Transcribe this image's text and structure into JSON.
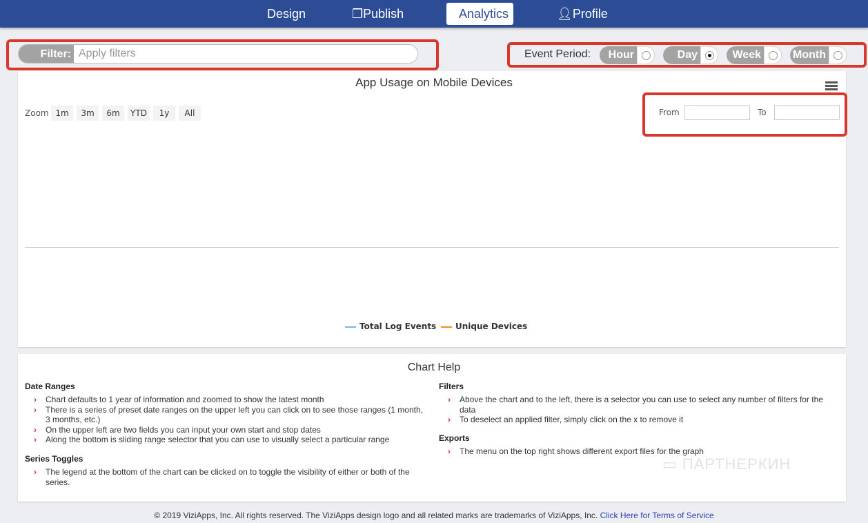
{
  "nav": {
    "tabs": [
      {
        "label": "Design"
      },
      {
        "label": "Publish",
        "icon": "copy-icon"
      },
      {
        "label": "Analytics",
        "active": true
      },
      {
        "label": "Profile",
        "icon": "user-icon"
      }
    ]
  },
  "filter": {
    "label": "Filter:",
    "placeholder": "Apply filters",
    "value": ""
  },
  "event_period": {
    "label": "Event Period:",
    "options": [
      {
        "label": "Hour",
        "selected": false
      },
      {
        "label": "Day",
        "selected": true
      },
      {
        "label": "Week",
        "selected": false
      },
      {
        "label": "Month",
        "selected": false
      }
    ]
  },
  "chart": {
    "title": "App Usage on Mobile Devices",
    "zoom_label": "Zoom",
    "zoom_buttons": [
      "1m",
      "3m",
      "6m",
      "YTD",
      "1y",
      "All"
    ],
    "from_label": "From",
    "to_label": "To",
    "from_value": "",
    "to_value": "",
    "legend": [
      {
        "name": "Total Log Events",
        "color": "#7cb5ec"
      },
      {
        "name": "Unique Devices",
        "color": "#f28f1c"
      }
    ]
  },
  "help": {
    "title": "Chart Help",
    "date_ranges": {
      "heading": "Date Ranges",
      "items": [
        "Chart defaults to 1 year of information and zoomed to show the latest month",
        "There is a series of preset date ranges on the upper left you can click on to see those ranges (1 month, 3 months, etc.)",
        "On the upper left are two fields you can input your own start and stop dates",
        "Along the bottom is sliding range selector that you can use to visually select a particular range"
      ]
    },
    "series_toggles": {
      "heading": "Series Toggles",
      "items": [
        "The legend at the bottom of the chart can be clicked on to toggle the visibility of either or both of the series."
      ]
    },
    "filters": {
      "heading": "Filters",
      "items": [
        "Above the chart and to the left, there is a selector you can use to select any number of filters for the data",
        "To deselect an applied filter, simply click on the x to remove it"
      ]
    },
    "exports": {
      "heading": "Exports",
      "items": [
        "The menu on the top right shows different export files for the graph"
      ]
    }
  },
  "watermark": "ПАРТНЕРКИН",
  "footer": {
    "text": "© 2019 ViziApps, Inc. All rights reserved. The ViziApps design logo and all related marks are trademarks of ViziApps, Inc.",
    "link": "Click Here for Terms of Service"
  }
}
